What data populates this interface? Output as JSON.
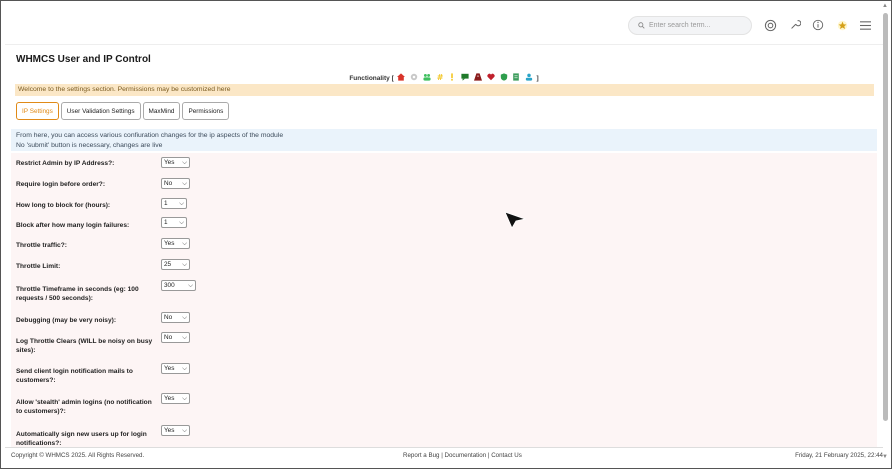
{
  "header": {
    "search_placeholder": "Enter search term...",
    "icons": [
      "gear-icon",
      "wrench-icon",
      "info-icon",
      "star-icon",
      "menu-icon"
    ]
  },
  "page": {
    "title": "WHMCS User and IP Control",
    "functionality_label": "Functionality [",
    "functionality_close": "]",
    "welcome": "Welcome to the settings section. Permissions may be customized here"
  },
  "tabs": [
    {
      "label": "IP Settings",
      "active": true
    },
    {
      "label": "User Validation Settings",
      "active": false
    },
    {
      "label": "MaxMind",
      "active": false
    },
    {
      "label": "Permissions",
      "active": false
    }
  ],
  "info": {
    "line1": "From here, you can access various confiuration changes for the ip aspects of the module",
    "line2": "No 'submit' button is necessary, changes are live"
  },
  "settings": [
    {
      "label": "Restrict Admin by IP Address?:",
      "value": "Yes"
    },
    {
      "label": "Require login before order?:",
      "value": "No"
    },
    {
      "label": "How long to block for (hours):",
      "value": "1"
    },
    {
      "label": "Block after how many login failures:",
      "value": "1"
    },
    {
      "label": "Throttle traffic?:",
      "value": "Yes"
    },
    {
      "label": "Throttle Limit:",
      "value": "25"
    },
    {
      "label": "Throttle Timeframe in seconds (eg: 100 requests / 500 seconds):",
      "value": "300"
    },
    {
      "label": "Debugging (may be very noisy):",
      "value": "No"
    },
    {
      "label": "Log Throttle Clears (WILL be noisy on busy sites):",
      "value": "No"
    },
    {
      "label": "Send client login notification mails to customers?:",
      "value": "Yes"
    },
    {
      "label": "Allow 'stealth' admin logins (no notification to customers)?:",
      "value": "Yes"
    },
    {
      "label": "Automatically sign new users up for login notifications?:",
      "value": "Yes"
    }
  ],
  "footer": {
    "copyright": "Copyright © WHMCS 2025. All Rights Reserved.",
    "report_bug": "Report a Bug",
    "documentation": "Documentation",
    "contact_us": "Contact Us",
    "sep": " | ",
    "date": "Friday, 21 February 2025, 22:44"
  },
  "colors": {
    "accent": "#e08a17",
    "welcome_bg": "#fbe7c6",
    "info_bg": "#eaf3fb",
    "settings_bg": "#fdf5f5"
  }
}
